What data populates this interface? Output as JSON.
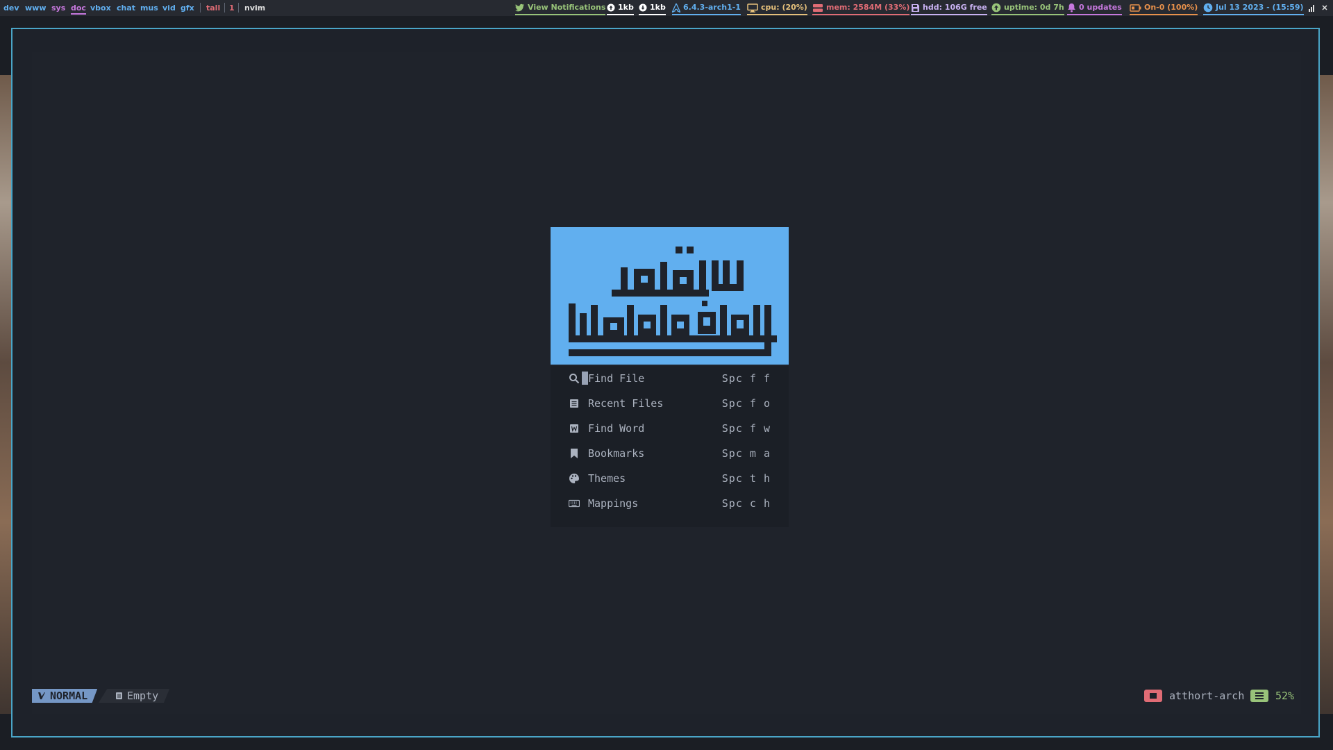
{
  "workspaces": [
    {
      "label": "dev",
      "color": "#61afef"
    },
    {
      "label": "www",
      "color": "#61afef"
    },
    {
      "label": "sys",
      "color": "#c678dd"
    },
    {
      "label": "doc",
      "color": "#c678dd"
    },
    {
      "label": "vbox",
      "color": "#61afef"
    },
    {
      "label": "chat",
      "color": "#61afef"
    },
    {
      "label": "mus",
      "color": "#61afef"
    },
    {
      "label": "vid",
      "color": "#61afef"
    },
    {
      "label": "gfx",
      "color": "#61afef"
    }
  ],
  "layout": "tall",
  "window_count": "1",
  "window_title": "nvim",
  "widgets": {
    "notifications": "View Notifications",
    "net_up": "1kb",
    "net_down": "1kb",
    "kernel": "6.4.3-arch1-1",
    "cpu": "cpu: (20%)",
    "mem": "mem: 2584M (33%)",
    "hdd": "hdd: 106G free",
    "uptime": "uptime: 0d 7h",
    "updates": "0 updates",
    "battery": "On-0 (100%)",
    "clock": "Jul 13 2023 - (15:59)"
  },
  "colors": {
    "notifications": "#98c379",
    "net": "#ffffff",
    "kernel": "#61afef",
    "cpu": "#e5c07b",
    "mem": "#e06c75",
    "hdd": "#c8b1f1",
    "uptime": "#98c379",
    "updates": "#c678dd",
    "battery": "#e8914b",
    "clock": "#61afef",
    "logo_bg": "#61afef",
    "frame": "#4aa5c7"
  },
  "dashboard": {
    "items": [
      {
        "icon": "search-icon",
        "label": "Find File",
        "key": "Spc f f"
      },
      {
        "icon": "file-icon",
        "label": "Recent Files",
        "key": "Spc f o"
      },
      {
        "icon": "word-icon",
        "label": "Find Word",
        "key": "Spc f w"
      },
      {
        "icon": "bookmark-icon",
        "label": "Bookmarks",
        "key": "Spc m a"
      },
      {
        "icon": "palette-icon",
        "label": "Themes",
        "key": "Spc t h"
      },
      {
        "icon": "keyboard-icon",
        "label": "Mappings",
        "key": "Spc c h"
      }
    ]
  },
  "statusline": {
    "mode": "NORMAL",
    "file": "Empty",
    "host": "atthort-arch",
    "progress": "52%"
  }
}
